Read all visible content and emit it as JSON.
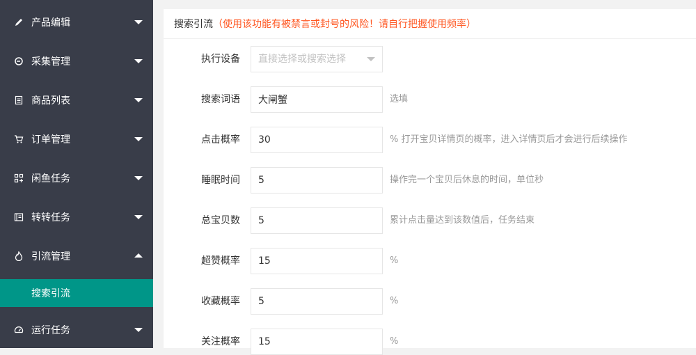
{
  "sidebar": {
    "items": [
      {
        "label": "产品编辑",
        "icon": "pencil-icon"
      },
      {
        "label": "采集管理",
        "icon": "collect-icon"
      },
      {
        "label": "商品列表",
        "icon": "list-icon"
      },
      {
        "label": "订单管理",
        "icon": "cart-icon"
      },
      {
        "label": "闲鱼任务",
        "icon": "grid-icon"
      },
      {
        "label": "转转任务",
        "icon": "book-icon"
      },
      {
        "label": "引流管理",
        "icon": "fire-icon",
        "expanded": true
      },
      {
        "label": "运行任务",
        "icon": "gauge-icon"
      }
    ],
    "active_subitem": "搜索引流",
    "active_color": "#009688",
    "background": "#393d49"
  },
  "panel": {
    "title": "搜索引流",
    "warning_open": "（",
    "warning": "使用该功能有被禁言或封号的风险！请自行把握使用频率",
    "warning_close": "）",
    "warning_color": "#ff5722"
  },
  "form": {
    "device": {
      "label": "执行设备",
      "placeholder": "直接选择或搜索选择"
    },
    "keyword": {
      "label": "搜索词语",
      "value": "大闸蟹",
      "hint": "选填"
    },
    "click_rate": {
      "label": "点击概率",
      "value": "30",
      "hint": "% 打开宝贝详情页的概率，进入详情页后才会进行后续操作"
    },
    "sleep_time": {
      "label": "睡眠时间",
      "value": "5",
      "hint": "操作完一个宝贝后休息的时间，单位秒"
    },
    "total_items": {
      "label": "总宝贝数",
      "value": "5",
      "hint": "累计点击量达到该数值后，任务结束"
    },
    "like_rate": {
      "label": "超赞概率",
      "value": "15",
      "hint": "%"
    },
    "fav_rate": {
      "label": "收藏概率",
      "value": "5",
      "hint": "%"
    },
    "follow_rate": {
      "label": "关注概率",
      "value": "15",
      "hint": "%"
    }
  }
}
